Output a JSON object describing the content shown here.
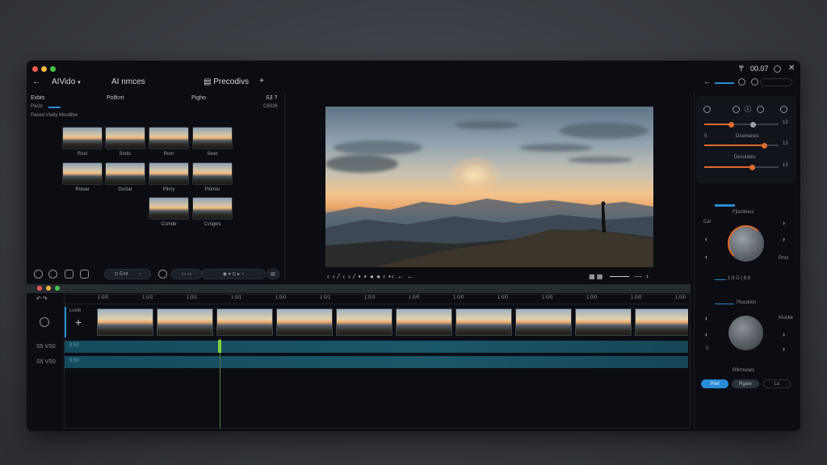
{
  "window": {
    "title_left": "AIVido",
    "title_mid": "AI nmces",
    "title_right": "Precodivs",
    "add_symbol": "+",
    "back_symbol": "←",
    "status_time": "00.07",
    "status_glyph": "₸"
  },
  "left_panel": {
    "header_cols": [
      "Exbts",
      "Polfcnt",
      "Pigho",
      "S3 ?"
    ],
    "row2_label": "Pacts",
    "row2_right": "C8336",
    "row3_label": "Paced Vlatiy Mouttlbe",
    "thumb_labels": [
      "Rsol",
      "Smitc",
      "Rom",
      "Swer",
      "Rowar",
      "Dsctar",
      "Pilmy",
      "Plomer",
      "Csmde",
      "Cvsgws"
    ],
    "toolbar_chip": "Emt"
  },
  "viewer": {
    "controls_left": "‹ › ⁄ ‹ › ⁄ ▪ ▪ ◂ ◂ ‹ •‹ ← ←",
    "controls_right": "›"
  },
  "timeline": {
    "ruler_labels": [
      "1:0/0",
      "1:0/2",
      "1:0/1",
      "1:0/1",
      "1:0/0",
      "1:0/1",
      "1:0/3",
      "1:0/0",
      "1:0/0",
      "1:0/0",
      "1:0/0",
      "1:0/0",
      "1:0/0",
      "1:0/0"
    ],
    "row_labels": [
      "S5 VS0",
      "S5 VS0"
    ],
    "track_labels": [
      "9.50",
      "9.50"
    ],
    "add_label": "Luvie"
  },
  "right_panel": {
    "top_right_value": "13",
    "card1": {
      "slider_labels": [
        "Dcamanes",
        "Decolates"
      ],
      "right_values": [
        "13",
        "13",
        "13"
      ]
    },
    "card2": {
      "title": "Fjiscitious",
      "left_label": "Cal",
      "right_label": "Pros",
      "bottom_text": "1.9 O | 8.9"
    },
    "card3": {
      "title": "Plucatios",
      "right_label": "Kiucke",
      "bottom_label": "Rllrmunes",
      "buttons": [
        "Piiel",
        "Rgeie",
        "Lo"
      ]
    }
  },
  "colors": {
    "accent": "#2a8bd6",
    "orange": "#e06a2d",
    "track": "#1a5669",
    "playhead": "#7fd13a"
  }
}
